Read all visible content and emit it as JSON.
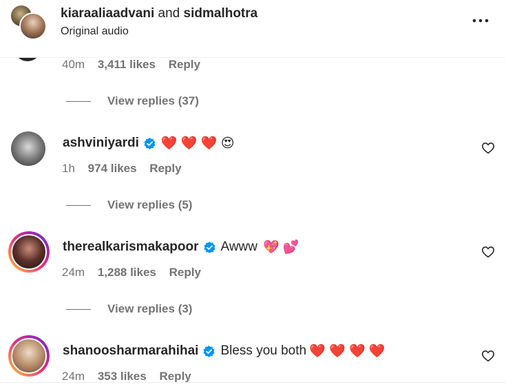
{
  "header": {
    "user1": "kiaraaliaadvani",
    "and_text": "and",
    "user2": "sidmalhotra",
    "subtitle": "Original audio",
    "more_icon": "more-horizontal-icon"
  },
  "top_comment": {
    "time": "40m",
    "likes": "3,411 likes",
    "reply": "Reply",
    "view_replies": "View replies (37)"
  },
  "comments": [
    {
      "username": "ashviniyardi",
      "text": "",
      "emojis": "❤️ ❤️ ❤️ 😍",
      "time": "1h",
      "likes": "974 likes",
      "reply": "Reply",
      "view_replies": "View replies (5)"
    },
    {
      "username": "therealkarismakapoor",
      "text": "Awww",
      "emojis": "💖 💕",
      "time": "24m",
      "likes": "1,288 likes",
      "reply": "Reply",
      "view_replies": "View replies (3)"
    },
    {
      "username": "shanoosharmarahihai",
      "text": "Bless you both",
      "emojis": "❤️ ❤️ ❤️ ❤️",
      "time": "24m",
      "likes": "353 likes",
      "reply": "Reply"
    }
  ],
  "colors": {
    "verified": "#0095f6",
    "text": "#262626",
    "secondary": "#737373"
  }
}
